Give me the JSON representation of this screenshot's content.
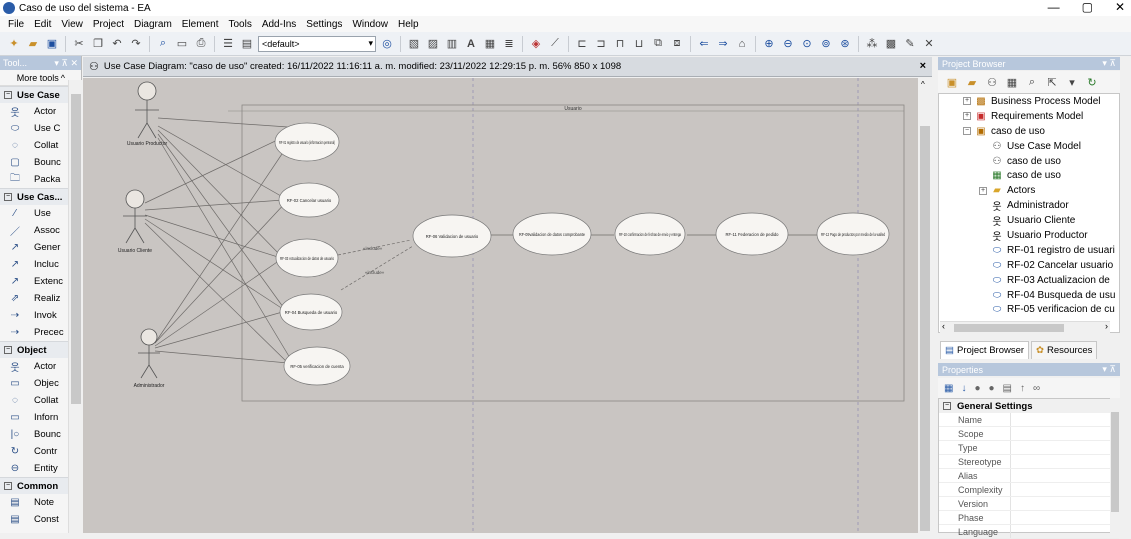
{
  "window": {
    "title": "Caso de uso del sistema - EA",
    "minimize": "—",
    "maximize": "▢",
    "close": "✕"
  },
  "menu": [
    "File",
    "Edit",
    "View",
    "Project",
    "Diagram",
    "Element",
    "Tools",
    "Add-Ins",
    "Settings",
    "Window",
    "Help"
  ],
  "toolbar": {
    "style_select": "<default>"
  },
  "toolbox": {
    "title": "Tool...",
    "more_tools": "More tools",
    "groups": [
      {
        "label": "Use Case",
        "items": [
          {
            "label": "Actor",
            "icon": "actor-icon"
          },
          {
            "label": "Use C",
            "icon": "use-case-icon"
          },
          {
            "label": "Collat",
            "icon": "collaboration-icon"
          },
          {
            "label": "Bounc",
            "icon": "boundary-icon"
          },
          {
            "label": "Packa",
            "icon": "package-icon"
          }
        ]
      },
      {
        "label": "Use Cas...",
        "items": [
          {
            "label": "Use",
            "icon": "use-icon"
          },
          {
            "label": "Assoc",
            "icon": "association-icon"
          },
          {
            "label": "Gener",
            "icon": "generalization-icon"
          },
          {
            "label": "Incluc",
            "icon": "include-icon"
          },
          {
            "label": "Extenc",
            "icon": "extend-icon"
          },
          {
            "label": "Realiz",
            "icon": "realize-icon"
          },
          {
            "label": "Invok",
            "icon": "invokes-icon"
          },
          {
            "label": "Precec",
            "icon": "precedes-icon"
          }
        ]
      },
      {
        "label": "Object",
        "items": [
          {
            "label": "Actor",
            "icon": "actor-icon"
          },
          {
            "label": "Objec",
            "icon": "object-icon"
          },
          {
            "label": "Collat",
            "icon": "collaboration-icon"
          },
          {
            "label": "Inforn",
            "icon": "information-icon"
          },
          {
            "label": "Bounc",
            "icon": "boundary-icon"
          },
          {
            "label": "Contr",
            "icon": "control-icon"
          },
          {
            "label": "Entity",
            "icon": "entity-icon"
          }
        ]
      },
      {
        "label": "Common",
        "items": [
          {
            "label": "Note",
            "icon": "note-icon"
          },
          {
            "label": "Const",
            "icon": "constraint-icon"
          }
        ]
      }
    ]
  },
  "diagram": {
    "header": "Use Case Diagram: \"caso de uso\"   created: 16/11/2022 11:16:11 a. m.  modified: 23/11/2022 12:29:15 p. m.   56%   850 x 1098",
    "boundary_label": "Usuario",
    "actors": [
      "Usuario Productor",
      "Usuario Cliente",
      "Administrador"
    ],
    "use_cases": {
      "rf01": "RF-01 registro de usuario (informacion personal)",
      "rf02": "RF-02 Cancelar usuario",
      "rf03": "RF-03 Actualizacion de datos de usuario",
      "rf04": "RF-04 Busqueda de usuario",
      "rf05": "RF-05 verificacion de cuenta",
      "rf06": "RF-06 Validacion de usuario",
      "rf09": "RF-09validacion de datos comprobante",
      "rf10": "RF-10 confirmacion de fechas de envio y entrega",
      "rf11": "RF-11 Federacion de pedido",
      "rf12": "RF-12 Pago de productos por medio de la walled"
    },
    "include_label_1": "«include»",
    "include_label_2": "«include»"
  },
  "project_browser": {
    "title": "Project Browser",
    "tree": [
      {
        "indent": 1,
        "exp": "+",
        "icon": "business-model-icon",
        "label": "Business Process Model"
      },
      {
        "indent": 1,
        "exp": "+",
        "icon": "requirements-model-icon",
        "label": "Requirements Model"
      },
      {
        "indent": 1,
        "exp": "-",
        "icon": "package-icon",
        "label": "caso de uso"
      },
      {
        "indent": 2,
        "exp": "",
        "icon": "use-case-model-icon",
        "label": "Use Case Model"
      },
      {
        "indent": 2,
        "exp": "",
        "icon": "use-case-model-icon",
        "label": "caso de uso"
      },
      {
        "indent": 2,
        "exp": "",
        "icon": "diagram-icon",
        "label": "caso de uso"
      },
      {
        "indent": 2,
        "exp": "+",
        "icon": "folder-icon",
        "label": "Actors"
      },
      {
        "indent": 2,
        "exp": "",
        "icon": "actor-icon",
        "label": "Administrador"
      },
      {
        "indent": 2,
        "exp": "",
        "icon": "actor-icon",
        "label": "Usuario Cliente"
      },
      {
        "indent": 2,
        "exp": "",
        "icon": "actor-icon",
        "label": "Usuario Productor"
      },
      {
        "indent": 2,
        "exp": "",
        "icon": "use-case-icon",
        "label": "RF-01 registro de usuari"
      },
      {
        "indent": 2,
        "exp": "",
        "icon": "use-case-icon",
        "label": "RF-02 Cancelar usuario"
      },
      {
        "indent": 2,
        "exp": "",
        "icon": "use-case-icon",
        "label": "RF-03 Actualizacion de"
      },
      {
        "indent": 2,
        "exp": "",
        "icon": "use-case-icon",
        "label": "RF-04 Busqueda de usu"
      },
      {
        "indent": 2,
        "exp": "",
        "icon": "use-case-icon",
        "label": "RF-05 verificacion de cu"
      }
    ],
    "tabs": [
      "Project Browser",
      "Resources"
    ]
  },
  "properties": {
    "title": "Properties",
    "section": "General Settings",
    "rows": [
      "Name",
      "Scope",
      "Type",
      "Stereotype",
      "Alias",
      "Complexity",
      "Version",
      "Phase",
      "Language"
    ]
  }
}
